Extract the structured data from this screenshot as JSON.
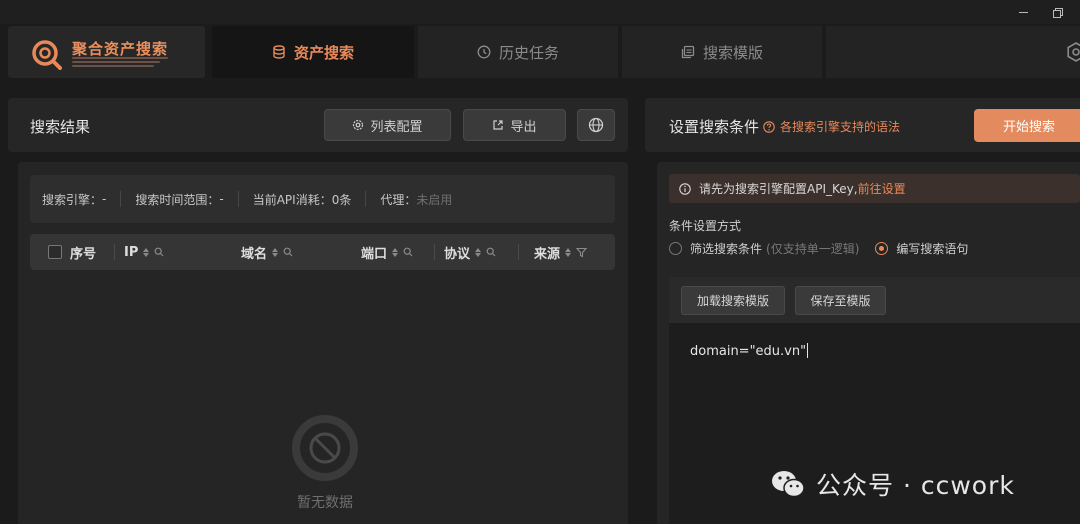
{
  "brand": {
    "title": "聚合资产搜索"
  },
  "nav": {
    "tabs": [
      {
        "label": "资产搜索",
        "icon": "database-icon",
        "active": true
      },
      {
        "label": "历史任务",
        "icon": "clock-icon",
        "active": false
      },
      {
        "label": "搜索模版",
        "icon": "template-icon",
        "active": false
      }
    ],
    "accent": "#e8895a"
  },
  "left": {
    "title": "搜索结果",
    "buttons": {
      "columns": "列表配置",
      "export": "导出"
    },
    "info": {
      "engine_label": "搜索引擎：",
      "engine_value": "-",
      "range_label": "搜索时间范围：",
      "range_value": "-",
      "api_label": "当前API消耗：",
      "api_value": "0条",
      "proxy_label": "代理：",
      "proxy_value": "未启用"
    },
    "columns": [
      "序号",
      "IP",
      "域名",
      "端口",
      "协议",
      "来源"
    ],
    "empty_text": "暂无数据"
  },
  "right": {
    "title": "设置搜索条件",
    "syntax_link": "各搜索引擎支持的语法",
    "start_button": "开始搜索",
    "warning": {
      "text": "请先为搜索引擎配置API_Key,",
      "link": "前往设置"
    },
    "condition_label": "条件设置方式",
    "mode_filter": "筛选搜索条件",
    "mode_filter_note": "(仅支持单一逻辑)",
    "mode_syntax": "编写搜索语句",
    "load_button": "加载搜索模版",
    "save_button": "保存至模版",
    "query": "domain=\"edu.vn\""
  },
  "watermark": "公众号 · ccwork"
}
